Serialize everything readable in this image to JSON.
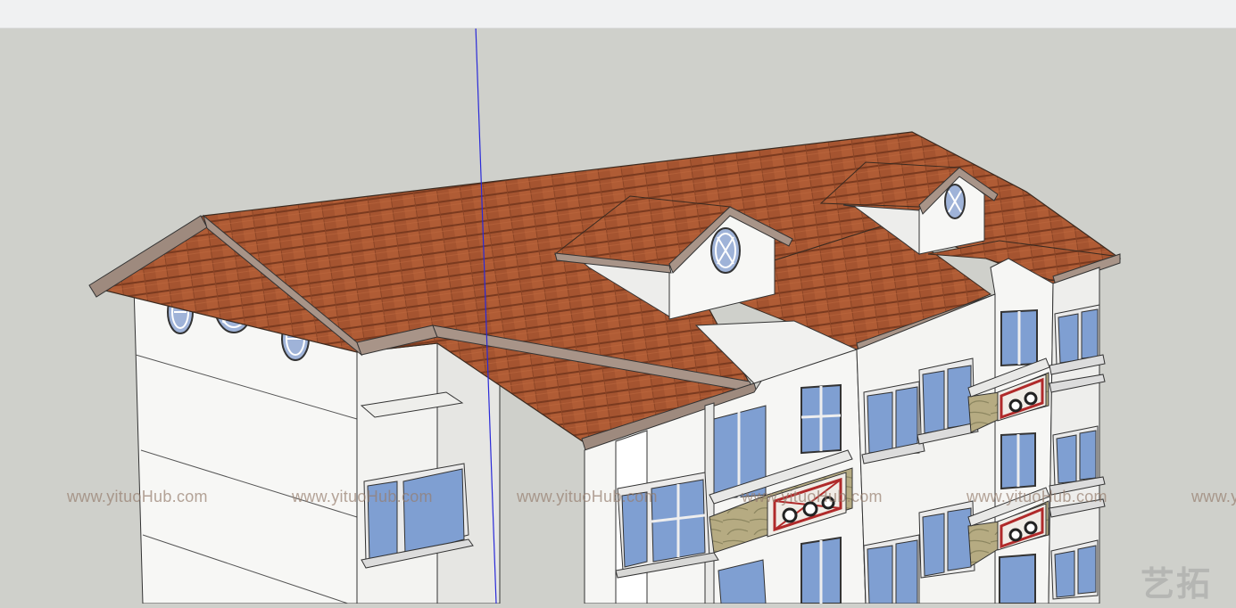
{
  "app": {
    "theme": {
      "sky": "#cfd0cb",
      "toolbar_bg": "#f0f1f2",
      "axis_blue": "#2a2ad8"
    }
  },
  "watermark": {
    "url_text": "www.yituoHub.com",
    "logo_text": "艺拓",
    "color": "#9a7e6e"
  },
  "model": {
    "roof_color": "#a8552f",
    "wall_color": "#f6f6f4",
    "glass_color": "#8aa4d6",
    "balcony_stone": "#b8ad84",
    "balcony_rail": "#b02a2a"
  }
}
